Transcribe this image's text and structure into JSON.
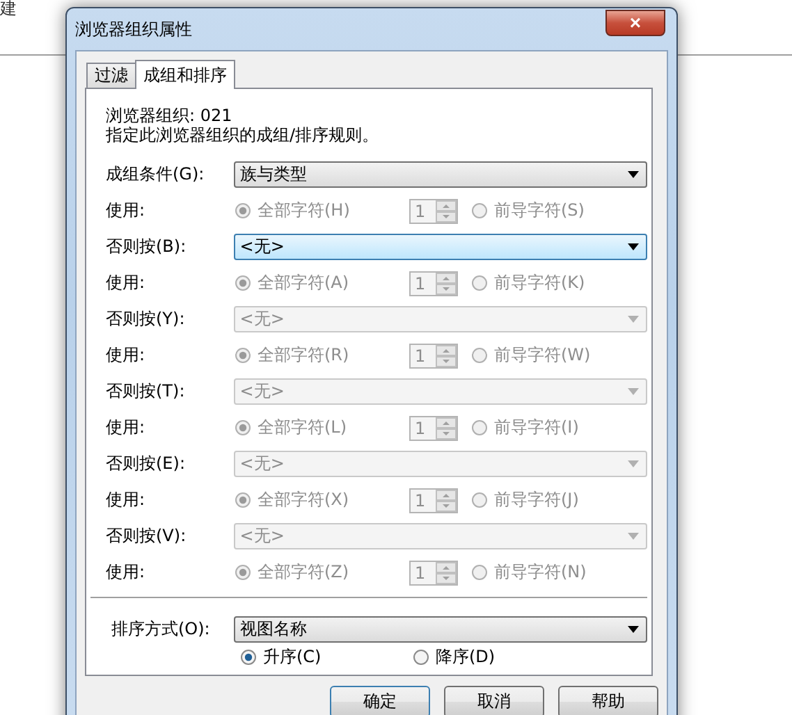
{
  "background": {
    "text": "建"
  },
  "window": {
    "title": "浏览器组织属性",
    "close": "×"
  },
  "tabs": [
    {
      "label": "过滤",
      "selected": false
    },
    {
      "label": "成组和排序",
      "selected": true
    }
  ],
  "info": {
    "org": "浏览器组织: 021",
    "description": "指定此浏览器组织的成组/排序规则。"
  },
  "groups": [
    {
      "label": "成组条件(G):",
      "value": "族与类型",
      "disabled": false,
      "focused": false,
      "use_label": "使用:",
      "all_label": "全部字符(H)",
      "all_checked": true,
      "count": "1",
      "leading_label": "前导字符(S)",
      "leading_checked": false
    },
    {
      "label": "否则按(B):",
      "value": "<无>",
      "disabled": false,
      "focused": true,
      "use_label": "使用:",
      "all_label": "全部字符(A)",
      "all_checked": true,
      "count": "1",
      "leading_label": "前导字符(K)",
      "leading_checked": false
    },
    {
      "label": "否则按(Y):",
      "value": "<无>",
      "disabled": true,
      "focused": false,
      "use_label": "使用:",
      "all_label": "全部字符(R)",
      "all_checked": true,
      "count": "1",
      "leading_label": "前导字符(W)",
      "leading_checked": false
    },
    {
      "label": "否则按(T):",
      "value": "<无>",
      "disabled": true,
      "focused": false,
      "use_label": "使用:",
      "all_label": "全部字符(L)",
      "all_checked": true,
      "count": "1",
      "leading_label": "前导字符(I)",
      "leading_checked": false
    },
    {
      "label": "否则按(E):",
      "value": "<无>",
      "disabled": true,
      "focused": false,
      "use_label": "使用:",
      "all_label": "全部字符(X)",
      "all_checked": true,
      "count": "1",
      "leading_label": "前导字符(J)",
      "leading_checked": false
    },
    {
      "label": "否则按(V):",
      "value": "<无>",
      "disabled": true,
      "focused": false,
      "use_label": "使用:",
      "all_label": "全部字符(Z)",
      "all_checked": true,
      "count": "1",
      "leading_label": "前导字符(N)",
      "leading_checked": false
    }
  ],
  "sort": {
    "label": "排序方式(O):",
    "value": "视图名称",
    "options": [
      {
        "label": "升序(C)",
        "selected": true
      },
      {
        "label": "降序(D)",
        "selected": false
      }
    ]
  },
  "buttons": [
    {
      "label": "确定",
      "default": true
    },
    {
      "label": "取消",
      "default": false
    },
    {
      "label": "帮助",
      "default": false
    }
  ]
}
